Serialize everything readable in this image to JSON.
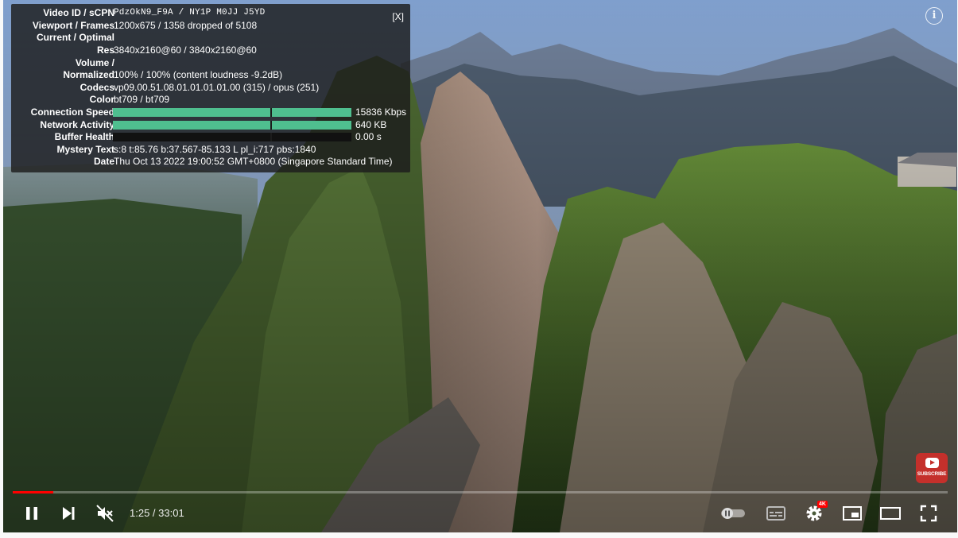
{
  "stats": {
    "close_label": "[X]",
    "rows": [
      {
        "key": "Video ID / sCPN",
        "value": "PdzOkN9_F9A / NY1P M0JJ J5YD"
      },
      {
        "key": "Viewport / Frames",
        "value": "1200x675 / 1358 dropped of 5108"
      },
      {
        "key": "Current / Optimal",
        "value": ""
      },
      {
        "key": "Res",
        "value": "3840x2160@60 / 3840x2160@60"
      },
      {
        "key": "Volume /",
        "value": ""
      },
      {
        "key": "Normalized",
        "value": "100% / 100% (content loudness -9.2dB)"
      },
      {
        "key": "Codecs",
        "value": "vp09.00.51.08.01.01.01.01.00 (315) / opus (251)"
      },
      {
        "key": "Color",
        "value": "bt709 / bt709"
      },
      {
        "key": "Connection Speed",
        "value": "15836 Kbps",
        "fill": 1.0
      },
      {
        "key": "Network Activity",
        "value": "640 KB",
        "fill": 1.0
      },
      {
        "key": "Buffer Health",
        "value": "0.00 s",
        "fill": 0.0
      },
      {
        "key": "Mystery Text",
        "value": "s:8 t:85.76 b:37.567-85.133 L pl_i:717 pbs:1840"
      },
      {
        "key": "Date",
        "value": "Thu Oct 13 2022 19:00:52 GMT+0800 (Singapore Standard Time)"
      }
    ],
    "graph_color": "#4fbf8f"
  },
  "overlay": {
    "info_label": "i",
    "subscribe_label": "SUBSCRIBE",
    "brand_color": "#c4302b"
  },
  "player": {
    "progress_played": 0.043,
    "progress_loaded": 0.043,
    "current_time": "1:25",
    "time_separator": " / ",
    "duration": "33:01",
    "quality_badge": "4K",
    "controls": [
      "pause-icon",
      "next-icon",
      "mute-icon",
      "autoplay-toggle-icon",
      "subtitles-icon",
      "settings-gear-icon",
      "miniplayer-icon",
      "theater-mode-icon",
      "fullscreen-icon"
    ],
    "accent_color": "#ff0000"
  }
}
